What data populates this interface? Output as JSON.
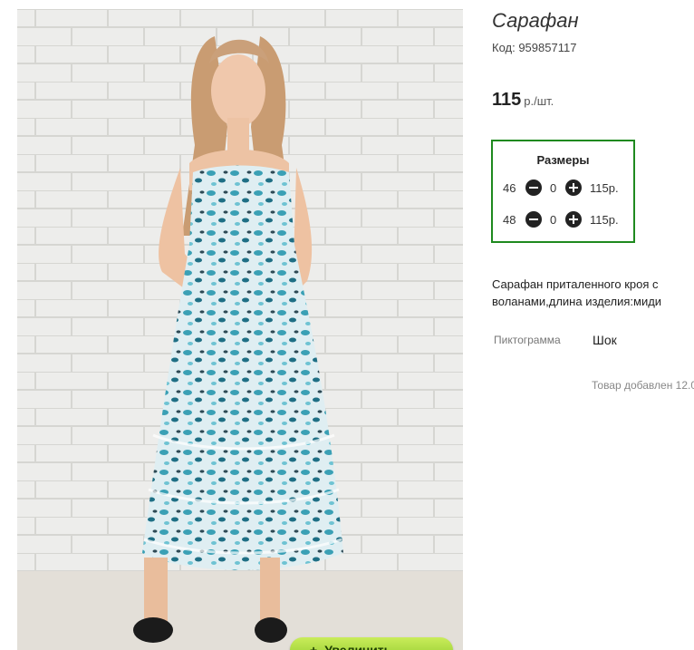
{
  "product": {
    "title": "Сарафан",
    "code": "Код: 959857117",
    "price": "115",
    "price_unit": "р./шт.",
    "description": "Сарафан приталенного кроя с воланами,длина изделия:миди",
    "pictogram_label": "Пиктограмма",
    "pictogram_value": "Шок",
    "added_text": "Товар добавлен 12.0"
  },
  "sizes": {
    "title": "Размеры",
    "rows": [
      {
        "size": "46",
        "qty": "0",
        "price": "115р."
      },
      {
        "size": "48",
        "qty": "0",
        "price": "115р."
      }
    ]
  },
  "photo": {
    "zoom_label": "Увеличить",
    "zoom_icon": "plus-icon"
  },
  "colors": {
    "sizes_border": "#1f8a1f",
    "zoom_button": "#a6d93b",
    "dress_print": "#3aa0b5"
  }
}
